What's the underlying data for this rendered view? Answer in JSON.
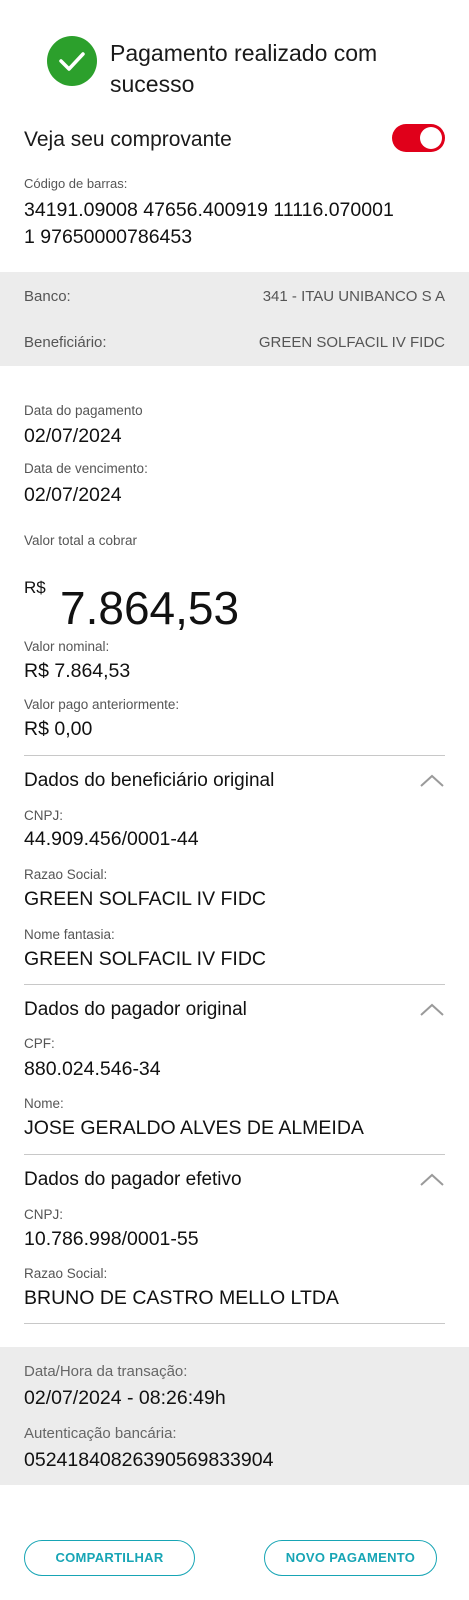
{
  "header": {
    "success_title": "Pagamento realizado com sucesso",
    "success_color": "#2ca02c"
  },
  "receipt_toggle": {
    "label": "Veja seu comprovante",
    "state": "on",
    "color": "#e0001a"
  },
  "barcode": {
    "label": "Código de barras:",
    "line1": "34191.09008 47656.400919 11116.070001",
    "line2": "1 97650000786453"
  },
  "bank_info": {
    "bank_label": "Banco:",
    "bank_value": "341 - ITAU UNIBANCO S A",
    "beneficiary_label": "Beneficiário:",
    "beneficiary_value": "GREEN SOLFACIL IV FIDC"
  },
  "dates": {
    "payment_label": "Data do pagamento",
    "payment_value": "02/07/2024",
    "due_label": "Data de vencimento:",
    "due_value": "02/07/2024"
  },
  "total": {
    "label": "Valor total a cobrar",
    "currency": "R$",
    "amount": "7.864,53"
  },
  "nominal": {
    "label": "Valor nominal:",
    "value": "R$ 7.864,53"
  },
  "previous": {
    "label": "Valor pago anteriormente:",
    "value": "R$ 0,00"
  },
  "original_beneficiary": {
    "title": "Dados do beneficiário original",
    "cnpj_label": "CNPJ:",
    "cnpj_value": "44.909.456/0001-44",
    "razao_label": "Razao Social:",
    "razao_value": "GREEN SOLFACIL IV FIDC",
    "fantasia_label": "Nome fantasia:",
    "fantasia_value": "GREEN SOLFACIL IV FIDC"
  },
  "original_payer": {
    "title": "Dados do pagador original",
    "cpf_label": "CPF:",
    "cpf_value": "880.024.546-34",
    "nome_label": "Nome:",
    "nome_value": "JOSE GERALDO ALVES DE ALMEIDA"
  },
  "effective_payer": {
    "title": "Dados do pagador efetivo",
    "cnpj_label": "CNPJ:",
    "cnpj_value": "10.786.998/0001-55",
    "razao_label": "Razao Social:",
    "razao_value": "BRUNO DE CASTRO MELLO LTDA"
  },
  "transaction": {
    "datetime_label": "Data/Hora da transação:",
    "datetime_value": "02/07/2024 - 08:26:49h",
    "auth_label": "Autenticação bancária:",
    "auth_value": "05241840826390569833904"
  },
  "actions": {
    "share_label": "COMPARTILHAR",
    "new_payment_label": "NOVO PAGAMENTO",
    "accent_color": "#17a5b5"
  }
}
